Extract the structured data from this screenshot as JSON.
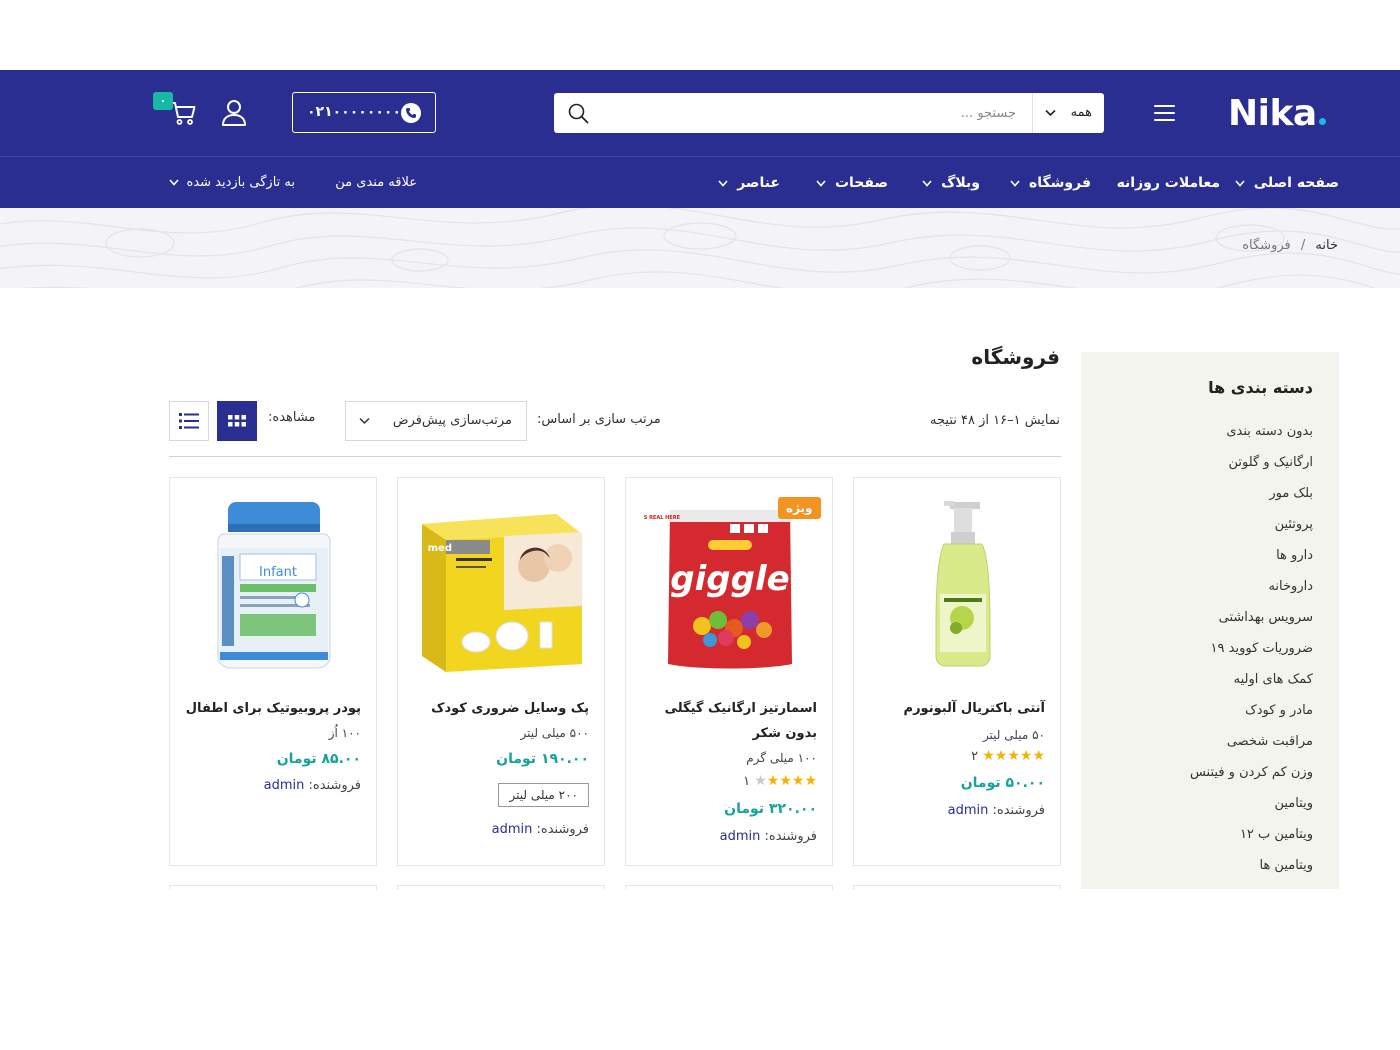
{
  "header": {
    "logo": "Nika",
    "search": {
      "category": "همه",
      "placeholder": "جستجو ..."
    },
    "phone": "۰۲۱۰۰۰۰۰۰۰۰",
    "cart_count": "۰"
  },
  "nav": {
    "items": [
      "صفحه اصلی",
      "معاملات روزانه",
      "فروشگاه",
      "وبلاگ",
      "صفحات",
      "عناصر"
    ],
    "wishlist": "علاقه مندی من",
    "recently_viewed": "به تازگی بازدید شده"
  },
  "breadcrumb": {
    "home": "خانه",
    "separator": "/",
    "current": "فروشگاه"
  },
  "sidebar": {
    "title": "دسته بندی ها",
    "categories": [
      "بدون دسته بندی",
      "ارگانیک و گلوتن",
      "بلک مور",
      "پروتئین",
      "دارو ها",
      "داروخانه",
      "سرویس بهداشتی",
      "ضروریات کووید ۱۹",
      "کمک های اولیه",
      "مادر و کودک",
      "مراقبت شخصی",
      "وزن کم کردن و فیتنس",
      "ویتامین",
      "ویتامین ب ۱۲",
      "ویتامین ها"
    ]
  },
  "shop": {
    "title": "فروشگاه",
    "result_count": "نمایش ۱–۱۶ از ۴۸ نتیجه",
    "sort_label": "مرتب سازی بر اساس:",
    "sort_value": "مرتب‌سازی پیش‌فرض",
    "view_label": "مشاهده:"
  },
  "products": [
    {
      "name": "آنتی باکتریال آلبونورم",
      "unit": "۵۰ میلی لیتر",
      "stars": 5,
      "rating_count": "۲",
      "price": "۵۰.۰۰ تومان",
      "seller_label": "فروشنده:",
      "seller": "admin"
    },
    {
      "badge": "ویژه",
      "name": "اسمارتیز ارگانیک گیگلی بدون شکر",
      "unit": "۱۰۰ میلی گرم",
      "stars": 4,
      "rating_count": "۱",
      "price": "۳۲۰.۰۰ تومان",
      "seller_label": "فروشنده:",
      "seller": "admin"
    },
    {
      "name": "پک وسایل ضروری کودک",
      "unit": "۵۰۰ میلی لیتر",
      "price": "۱۹۰.۰۰ تومان",
      "variant": "۲۰۰ میلی لیتر",
      "seller_label": "فروشنده:",
      "seller": "admin"
    },
    {
      "name": "پودر پروبیوتیک برای اطفال",
      "unit": "۱۰۰ اُز",
      "price": "۸۵.۰۰ تومان",
      "seller_label": "فروشنده:",
      "seller": "admin"
    }
  ],
  "colors": {
    "primary": "#2b2e91",
    "accent_price": "#18a39a",
    "badge": "#f39322",
    "sidebar_bg": "#f4f4ee",
    "star": "#f5b301"
  }
}
